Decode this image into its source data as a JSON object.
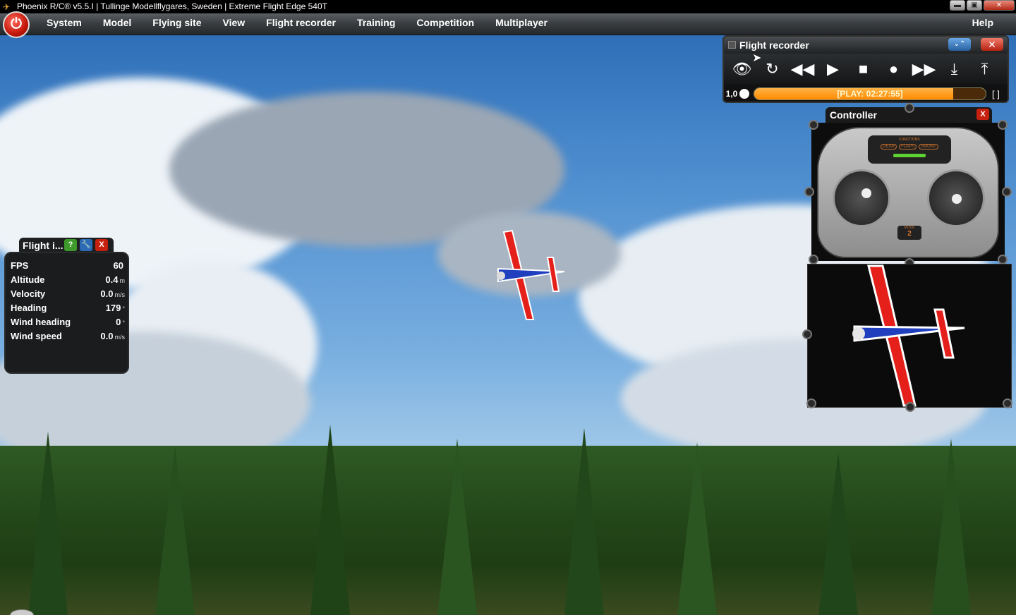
{
  "window": {
    "title": "Phoenix R/C® v5.5.I  |  Tullinge Modellflygares, Sweden  |  Extreme Flight Edge 540T",
    "buttons": {
      "minimize": "▬",
      "maximize": "▣",
      "close": "✕"
    }
  },
  "menu": {
    "items": [
      "System",
      "Model",
      "Flying site",
      "View",
      "Flight recorder",
      "Training",
      "Competition",
      "Multiplayer"
    ],
    "help": "Help"
  },
  "recorder": {
    "title": "Flight recorder",
    "collapse_glyph": "⌄⌃",
    "close_glyph": "✕",
    "speed": "1,0",
    "status": "[PLAY: 02:27:55]",
    "progress": 0.86,
    "fullscreen_glyph": "[ ]",
    "tools": [
      {
        "name": "view-icon",
        "glyph": "👁"
      },
      {
        "name": "loop-icon",
        "glyph": "↻"
      },
      {
        "name": "rewind-icon",
        "glyph": "◀◀"
      },
      {
        "name": "play-icon",
        "glyph": "▶"
      },
      {
        "name": "stop-icon",
        "glyph": "■"
      },
      {
        "name": "record-icon",
        "glyph": "●"
      },
      {
        "name": "fast-forward-icon",
        "glyph": "▶▶"
      },
      {
        "name": "import-icon",
        "glyph": "⤓"
      },
      {
        "name": "export-icon",
        "glyph": "⤒"
      }
    ]
  },
  "controller": {
    "title": "Controller",
    "close_label": "X",
    "functions_label": "FUNCTIONS",
    "switches": [
      "GEAR",
      "FLAPS",
      "SMOKE"
    ],
    "mode_label": "MODE",
    "mode": "2"
  },
  "flight_info": {
    "title": "Flight i...",
    "help_label": "?",
    "settings_label": "🔧",
    "close_label": "X",
    "rows": [
      {
        "label": "FPS",
        "value": "60",
        "unit": ""
      },
      {
        "label": "Altitude",
        "value": "0.4",
        "unit": "m"
      },
      {
        "label": "Velocity",
        "value": "0.0",
        "unit": "m/s"
      },
      {
        "label": "Heading",
        "value": "179",
        "unit": "°"
      },
      {
        "label": "Wind heading",
        "value": "0",
        "unit": "°"
      },
      {
        "label": "Wind speed",
        "value": "0.0",
        "unit": "m/s"
      }
    ]
  },
  "colors": {
    "accent_orange": "#ff8a00",
    "close_red": "#c8200e",
    "plane_red": "#e5201a",
    "plane_blue": "#1f3fbf"
  }
}
